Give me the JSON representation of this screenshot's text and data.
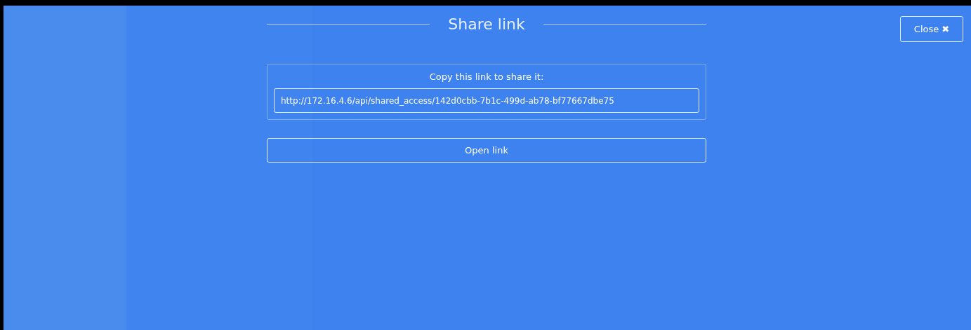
{
  "dialog": {
    "title": "Share link",
    "close_button": "Close",
    "close_symbol": "✖",
    "copy_label": "Copy this link to share it:",
    "link_value": "http://172.16.4.6/api/shared_access/142d0cbb-7b1c-499d-ab78-bf77667dbe75",
    "open_button": "Open link"
  }
}
